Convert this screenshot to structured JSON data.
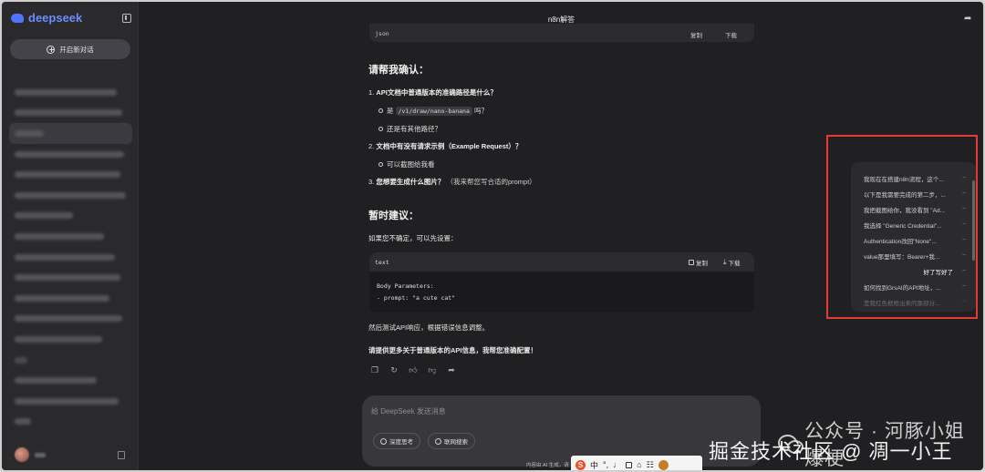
{
  "app": {
    "name": "deepseek",
    "accent": "#4f74ff"
  },
  "sidebar": {
    "new_chat_label": "开启新对话",
    "history_count": 18
  },
  "header": {
    "title": "n8n解答"
  },
  "message": {
    "codebar_top": {
      "lang": "json",
      "copy": "复制",
      "download": "下载"
    },
    "section1_title": "请帮我确认：",
    "q1": {
      "num": "1.",
      "text": "API文档中普通版本的准确路径是什么？"
    },
    "q1_b1_prefix": "是",
    "q1_b1_code": "/v1/draw/nano-banana",
    "q1_b1_suffix": "吗？",
    "q1_b2": "还是有其他路径？",
    "q2": {
      "num": "2.",
      "text": "文档中有没有请求示例（Example Request）？"
    },
    "q2_b1": "可以截图给我看",
    "q3": {
      "num": "3.",
      "text": "您想要生成什么图片？",
      "note": "（我来帮您写合适的prompt）"
    },
    "section2_title": "暂时建议：",
    "suggest_intro": "如果您不确定，可以先设置：",
    "codeblock": {
      "lang": "text",
      "copy": "复制",
      "download": "下载",
      "line1": "Body Parameters:",
      "line2": "- prompt: \"a cute cat\""
    },
    "after_code": "然后测试API响应，根据错误信息调整。",
    "closing": "请提供更多关于普通版本的API信息，我帮您准确配置！"
  },
  "composer": {
    "placeholder": "给 DeepSeek 发送消息",
    "deep_think": "深度思考",
    "web_search": "联网搜索",
    "disclaimer": "内容由 AI 生成，请"
  },
  "outline": {
    "items": [
      {
        "text": "我现在在搭建n8n流程，这个...",
        "role": "assistant"
      },
      {
        "text": "以下是我需要完成的第二步，...",
        "role": "assistant"
      },
      {
        "text": "我把截图给你，我没看到 \"Ad...",
        "role": "assistant"
      },
      {
        "text": "我选择 \"Generic Credential\"...",
        "role": "assistant"
      },
      {
        "text": "Authentication改回\"None\"...",
        "role": "assistant"
      },
      {
        "text": "value那里填写：Bearer+我...",
        "role": "assistant"
      },
      {
        "text": "好了写好了",
        "role": "user"
      },
      {
        "text": "如何找到GrsAI的API地址，...",
        "role": "assistant"
      },
      {
        "text": "是我红色框框出来的那部分...",
        "role": "assistant"
      }
    ],
    "highlight_color": "#e53935"
  },
  "ime": {
    "lang": "中"
  },
  "watermark": {
    "line1": "公众号 · 河豚小姐爆梗",
    "line2": "掘金技术社区 @ 凋一小王"
  }
}
